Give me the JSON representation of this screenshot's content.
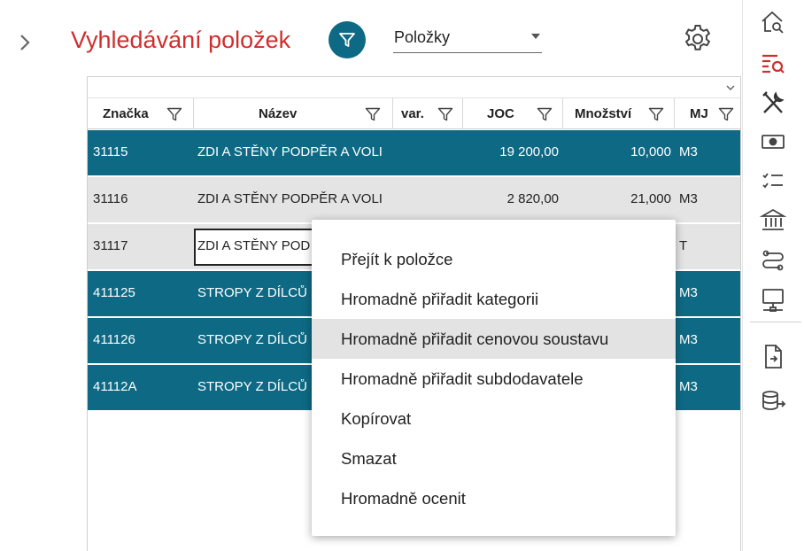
{
  "header": {
    "title": "Vyhledávání položek",
    "type_select": {
      "value": "Položky"
    }
  },
  "grid": {
    "columns": [
      {
        "key": "znacka",
        "label": "Značka"
      },
      {
        "key": "nazev",
        "label": "Název"
      },
      {
        "key": "var",
        "label": "var."
      },
      {
        "key": "joc",
        "label": "JOC"
      },
      {
        "key": "mnozstvi",
        "label": "Množství"
      },
      {
        "key": "mj",
        "label": "MJ"
      }
    ],
    "rows": [
      {
        "znacka": "31115",
        "nazev": "ZDI A STĚNY PODPĚR A VOLI",
        "joc": "19 200,00",
        "mnozstvi": "10,000",
        "mj": "M3",
        "selected": true
      },
      {
        "znacka": "31116",
        "nazev": "ZDI A STĚNY PODPĚR A VOLI",
        "joc": "2 820,00",
        "mnozstvi": "21,000",
        "mj": "M3",
        "selected": false
      },
      {
        "znacka": "31117",
        "nazev": "ZDI A STĚNY POD",
        "joc": "",
        "mnozstvi": "",
        "mj": "T",
        "selected": false,
        "editing": true
      },
      {
        "znacka": "411125",
        "nazev": "STROPY Z DÍLCŮ",
        "joc": "",
        "mnozstvi": "",
        "mj": "M3",
        "selected": true
      },
      {
        "znacka": "411126",
        "nazev": "STROPY Z DÍLCŮ",
        "joc": "",
        "mnozstvi": "",
        "mj": "M3",
        "selected": true
      },
      {
        "znacka": "41112A",
        "nazev": "STROPY Z DÍLCŮ",
        "joc": "",
        "mnozstvi": "",
        "mj": "M3",
        "selected": true
      }
    ]
  },
  "context_menu": {
    "items": [
      {
        "label": "Přejít k položce"
      },
      {
        "label": "Hromadně přiřadit kategorii"
      },
      {
        "label": "Hromadně přiřadit cenovou soustavu",
        "hover": true
      },
      {
        "label": "Hromadně přiřadit subdodavatele"
      },
      {
        "label": "Kopírovat"
      },
      {
        "label": "Smazat"
      },
      {
        "label": "Hromadně ocenit"
      }
    ]
  },
  "rail_icons": [
    "home-search-icon",
    "list-search-icon",
    "tools-icon",
    "money-icon",
    "checklist-icon",
    "bank-icon",
    "workflow-icon",
    "monitor-network-icon",
    "document-export-icon",
    "database-transfer-icon"
  ],
  "colors": {
    "accent": "#0e6a84",
    "title": "#cf2e2e",
    "active_rail": "#cf2e2e",
    "row_plain": "#e4e4e4",
    "menu_hover": "#e3e3e3"
  }
}
